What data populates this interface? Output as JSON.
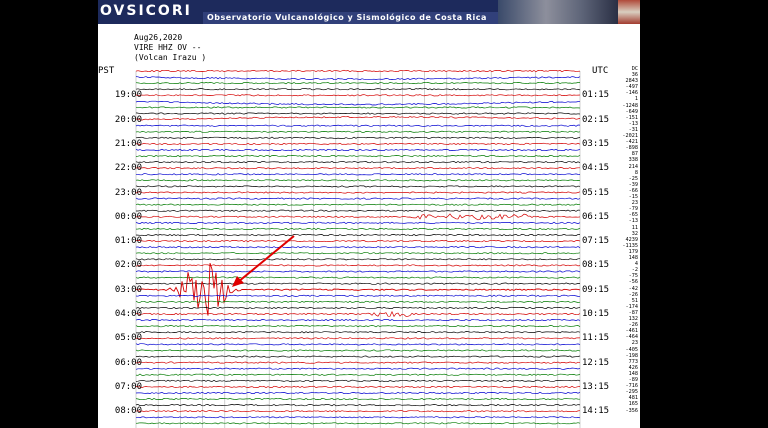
{
  "banner": {
    "title": "OVSICORI",
    "subtitle": "Observatorio Vulcanológico y Sismológico de Costa Rica"
  },
  "header": {
    "date": "Aug26,2020",
    "station": "VIRE HHZ OV --",
    "location": "(Volcan Irazu )"
  },
  "axis": {
    "left_label": "PST",
    "right_label": "UTC"
  },
  "hours": [
    {
      "pst": "19:00",
      "utc": "01:15"
    },
    {
      "pst": "20:00",
      "utc": "02:15"
    },
    {
      "pst": "21:00",
      "utc": "03:15"
    },
    {
      "pst": "22:00",
      "utc": "04:15"
    },
    {
      "pst": "23:00",
      "utc": "05:15"
    },
    {
      "pst": "00:00",
      "utc": "06:15"
    },
    {
      "pst": "01:00",
      "utc": "07:15"
    },
    {
      "pst": "02:00",
      "utc": "08:15"
    },
    {
      "pst": "03:00",
      "utc": "09:15"
    },
    {
      "pst": "04:00",
      "utc": "10:15"
    },
    {
      "pst": "05:00",
      "utc": "11:15"
    },
    {
      "pst": "06:00",
      "utc": "12:15"
    },
    {
      "pst": "07:00",
      "utc": "13:15"
    },
    {
      "pst": "08:00",
      "utc": "14:15"
    }
  ],
  "offsets_label": "DC",
  "offsets": [
    "36",
    "2843",
    "-497",
    "-146",
    "1",
    "-1248",
    "-649",
    "-151",
    "-13",
    "-31",
    "-2021",
    "-421",
    "-898",
    "87",
    "338",
    "214",
    "8",
    "-25",
    "-39",
    "-66",
    "-15",
    "23",
    "-79",
    "-65",
    "-13",
    "11",
    "32",
    "4239",
    "-1135",
    "179",
    "148",
    "4",
    "-2",
    "-75",
    "-56",
    "-42",
    "-26",
    "51",
    "-174",
    "-87",
    "132",
    "-26",
    "-461",
    "-464",
    "23",
    "-405",
    "-198",
    "773",
    "426",
    "148",
    "-89",
    "-716",
    "-295",
    "481",
    "165",
    "-356"
  ],
  "trace_colors": [
    "#d40000",
    "#0000d0",
    "#007a00",
    "#000000"
  ],
  "event": {
    "row": 9,
    "start_fraction": 0.115,
    "end_fraction": 0.19,
    "peak_amplitude_fraction": 1.0
  },
  "tremor": [
    {
      "row": 6,
      "start_fraction": 0.62,
      "end_fraction": 0.88
    },
    {
      "row": 10,
      "start_fraction": 0.52,
      "end_fraction": 0.62
    }
  ]
}
